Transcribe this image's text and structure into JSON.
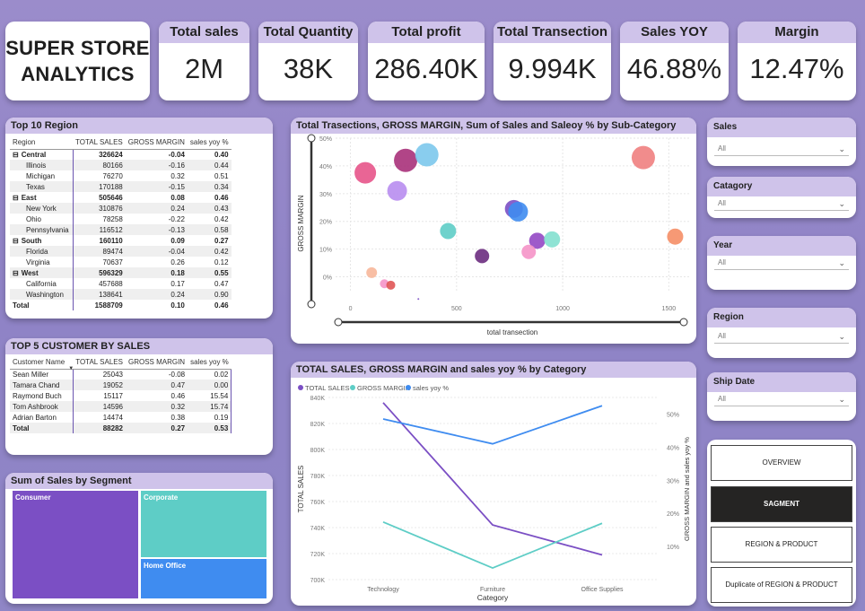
{
  "title": {
    "line1": "SUPER STORE",
    "line2": "ANALYTICS"
  },
  "kpis": [
    {
      "label": "Total sales",
      "value": "2M"
    },
    {
      "label": "Total Quantity",
      "value": "38K"
    },
    {
      "label": "Total profit",
      "value": "286.40K"
    },
    {
      "label": "Total Transection",
      "value": "9.994K"
    },
    {
      "label": "Sales YOY",
      "value": "46.88%"
    },
    {
      "label": "Margin",
      "value": "12.47%"
    }
  ],
  "region_table": {
    "title": "Top 10 Region",
    "headers": [
      "Region",
      "TOTAL SALES",
      "GROSS MARGIN",
      "sales yoy %"
    ],
    "rows": [
      {
        "name": "Central",
        "sales": "326624",
        "margin": "-0.04",
        "yoy": "0.40",
        "level": "group",
        "expander": "⊟"
      },
      {
        "name": "Illinois",
        "sales": "80166",
        "margin": "-0.16",
        "yoy": "0.44",
        "level": "child"
      },
      {
        "name": "Michigan",
        "sales": "76270",
        "margin": "0.32",
        "yoy": "0.51",
        "level": "child"
      },
      {
        "name": "Texas",
        "sales": "170188",
        "margin": "-0.15",
        "yoy": "0.34",
        "level": "child"
      },
      {
        "name": "East",
        "sales": "505646",
        "margin": "0.08",
        "yoy": "0.46",
        "level": "group",
        "expander": "⊟"
      },
      {
        "name": "New York",
        "sales": "310876",
        "margin": "0.24",
        "yoy": "0.43",
        "level": "child"
      },
      {
        "name": "Ohio",
        "sales": "78258",
        "margin": "-0.22",
        "yoy": "0.42",
        "level": "child"
      },
      {
        "name": "Pennsylvania",
        "sales": "116512",
        "margin": "-0.13",
        "yoy": "0.58",
        "level": "child"
      },
      {
        "name": "South",
        "sales": "160110",
        "margin": "0.09",
        "yoy": "0.27",
        "level": "group",
        "expander": "⊟"
      },
      {
        "name": "Florida",
        "sales": "89474",
        "margin": "-0.04",
        "yoy": "0.42",
        "level": "child"
      },
      {
        "name": "Virginia",
        "sales": "70637",
        "margin": "0.26",
        "yoy": "0.12",
        "level": "child"
      },
      {
        "name": "West",
        "sales": "596329",
        "margin": "0.18",
        "yoy": "0.55",
        "level": "group",
        "expander": "⊟"
      },
      {
        "name": "California",
        "sales": "457688",
        "margin": "0.17",
        "yoy": "0.47",
        "level": "child"
      },
      {
        "name": "Washington",
        "sales": "138641",
        "margin": "0.24",
        "yoy": "0.90",
        "level": "child"
      },
      {
        "name": "Total",
        "sales": "1588709",
        "margin": "0.10",
        "yoy": "0.46",
        "level": "total"
      }
    ]
  },
  "customer_table": {
    "title": "TOP 5 CUSTOMER BY SALES",
    "headers": [
      "Customer Name",
      "TOTAL SALES",
      "GROSS MARGIN",
      "sales yoy %"
    ],
    "sort_indicator": "▼",
    "rows": [
      {
        "name": "Sean Miller",
        "sales": "25043",
        "margin": "-0.08",
        "yoy": "0.02"
      },
      {
        "name": "Tamara Chand",
        "sales": "19052",
        "margin": "0.47",
        "yoy": "0.00"
      },
      {
        "name": "Raymond Buch",
        "sales": "15117",
        "margin": "0.46",
        "yoy": "15.54"
      },
      {
        "name": "Tom Ashbrook",
        "sales": "14596",
        "margin": "0.32",
        "yoy": "15.74"
      },
      {
        "name": "Adrian Barton",
        "sales": "14474",
        "margin": "0.38",
        "yoy": "0.19"
      },
      {
        "name": "Total",
        "sales": "88282",
        "margin": "0.27",
        "yoy": "0.53",
        "total": true
      }
    ]
  },
  "treemap": {
    "title": "Sum of Sales by Segment",
    "segments": [
      {
        "label": "Consumer",
        "color": "#7b4fc4"
      },
      {
        "label": "Corporate",
        "color": "#5ecdc6"
      },
      {
        "label": "Home Office",
        "color": "#3f8cf0"
      }
    ]
  },
  "slicers": [
    {
      "label": "Sales",
      "value": "All"
    },
    {
      "label": "Catagory",
      "value": "All"
    },
    {
      "label": "Year",
      "value": "All"
    },
    {
      "label": "Region",
      "value": "All"
    },
    {
      "label": "Ship Date",
      "value": "All"
    }
  ],
  "nav": {
    "buttons": [
      {
        "label": "OVERVIEW",
        "active": false
      },
      {
        "label": "SAGMENT",
        "active": true
      },
      {
        "label": "REGION & PRODUCT",
        "active": false
      },
      {
        "label": "Duplicate of REGION & PRODUCT",
        "active": false
      }
    ]
  },
  "chart_data": [
    {
      "type": "scatter",
      "title": "Total Trasections, GROSS MARGIN, Sum of Sales and Saleoy % by Sub-Category",
      "xlabel": "total transection",
      "ylabel": "GROSS MARGIN",
      "xlim": [
        -70,
        1600
      ],
      "ylim": [
        -5,
        50
      ],
      "xticks": [
        "0",
        "500",
        "1000",
        "1500"
      ],
      "yticks": [
        "0%",
        "10%",
        "20%",
        "30%",
        "40%",
        "50%"
      ],
      "grid": true,
      "points": [
        {
          "x": 70,
          "y": 37.5,
          "size": 12,
          "color": "#e7548a"
        },
        {
          "x": 260,
          "y": 42,
          "size": 13,
          "color": "#a8317a"
        },
        {
          "x": 360,
          "y": 44,
          "size": 13,
          "color": "#7cc8ec"
        },
        {
          "x": 220,
          "y": 31,
          "size": 11,
          "color": "#b88df0"
        },
        {
          "x": 460,
          "y": 16.5,
          "size": 9,
          "color": "#5ecdc6"
        },
        {
          "x": 620,
          "y": 7.5,
          "size": 8,
          "color": "#6b2c80"
        },
        {
          "x": 770,
          "y": 24.5,
          "size": 10,
          "color": "#7b4fc4"
        },
        {
          "x": 790,
          "y": 23.5,
          "size": 11,
          "color": "#3f8cf0"
        },
        {
          "x": 880,
          "y": 13,
          "size": 9,
          "color": "#9448c4"
        },
        {
          "x": 950,
          "y": 13.5,
          "size": 9,
          "color": "#83e0cf"
        },
        {
          "x": 840,
          "y": 9,
          "size": 8,
          "color": "#f594c8"
        },
        {
          "x": 1380,
          "y": 43,
          "size": 13,
          "color": "#f08080"
        },
        {
          "x": 1530,
          "y": 14.5,
          "size": 9,
          "color": "#f58e66"
        },
        {
          "x": 100,
          "y": 1.5,
          "size": 6,
          "color": "#f7b79a"
        },
        {
          "x": 160,
          "y": -2.5,
          "size": 5,
          "color": "#f594c8"
        },
        {
          "x": 190,
          "y": -3,
          "size": 5,
          "color": "#e05555"
        },
        {
          "x": 320,
          "y": -8,
          "size": 1,
          "color": "#7b4fc4"
        }
      ]
    },
    {
      "type": "line",
      "title": "TOTAL SALES, GROSS MARGIN and sales yoy % by Category",
      "xlabel": "Category",
      "ylabel": "TOTAL SALES",
      "y2label": "GROSS MARGIN and sales yoy %",
      "categories": [
        "Technology",
        "Furniture",
        "Office Supplies"
      ],
      "yticks": [
        "700K",
        "720K",
        "740K",
        "760K",
        "780K",
        "800K",
        "820K",
        "840K"
      ],
      "ylim": [
        700000,
        840000
      ],
      "y2ticks": [
        "10%",
        "20%",
        "30%",
        "40%",
        "50%"
      ],
      "y2lim": [
        0,
        55
      ],
      "legend": "top-left",
      "series": [
        {
          "name": "TOTAL SALES",
          "axis": "left",
          "color": "#7b4fc4",
          "values": [
            836000,
            742000,
            719000
          ]
        },
        {
          "name": "GROSS MARGIN",
          "axis": "right",
          "color": "#5ecdc6",
          "values": [
            17.4,
            3.5,
            17
          ]
        },
        {
          "name": "sales yoy %",
          "axis": "right",
          "color": "#3f8cf0",
          "values": [
            48.5,
            41,
            52.5
          ]
        }
      ]
    }
  ]
}
